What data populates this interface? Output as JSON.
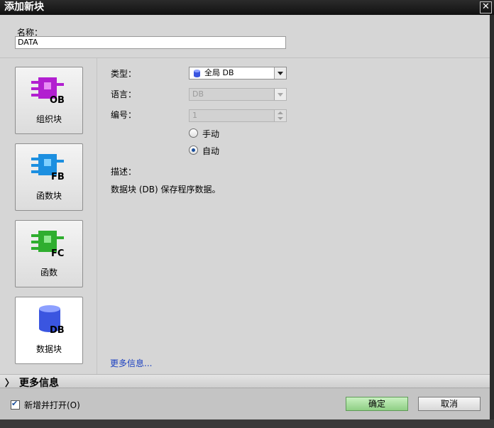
{
  "window": {
    "title": "添加新块",
    "close_symbol": "✕"
  },
  "name_field": {
    "label": "名称：",
    "value": "DATA"
  },
  "block_types": [
    {
      "label": "组织块",
      "badge": "OB",
      "color": "#b21fd0"
    },
    {
      "label": "函数块",
      "badge": "FB",
      "color": "#1c8fe0"
    },
    {
      "label": "函数",
      "badge": "FC",
      "color": "#2fae2f"
    },
    {
      "label": "数据块",
      "badge": "DB",
      "color": "#3a55e0",
      "selected": true
    }
  ],
  "fields": {
    "type_label": "类型：",
    "type_value": "全局 DB",
    "language_label": "语言：",
    "language_value": "DB",
    "number_label": "编号：",
    "number_value": "1",
    "radio_manual": "手动",
    "radio_auto": "自动",
    "radio_selected": "自动"
  },
  "description": {
    "label": "描述：",
    "text": "数据块 (DB) 保存程序数据。"
  },
  "more_info_link": "更多信息...",
  "more_info_bar": {
    "chevron": "〉",
    "title": "更多信息"
  },
  "footer": {
    "add_open_label": "新增并打开(O)",
    "add_open_checked": true,
    "ok_label": "确定",
    "cancel_label": "取消"
  }
}
